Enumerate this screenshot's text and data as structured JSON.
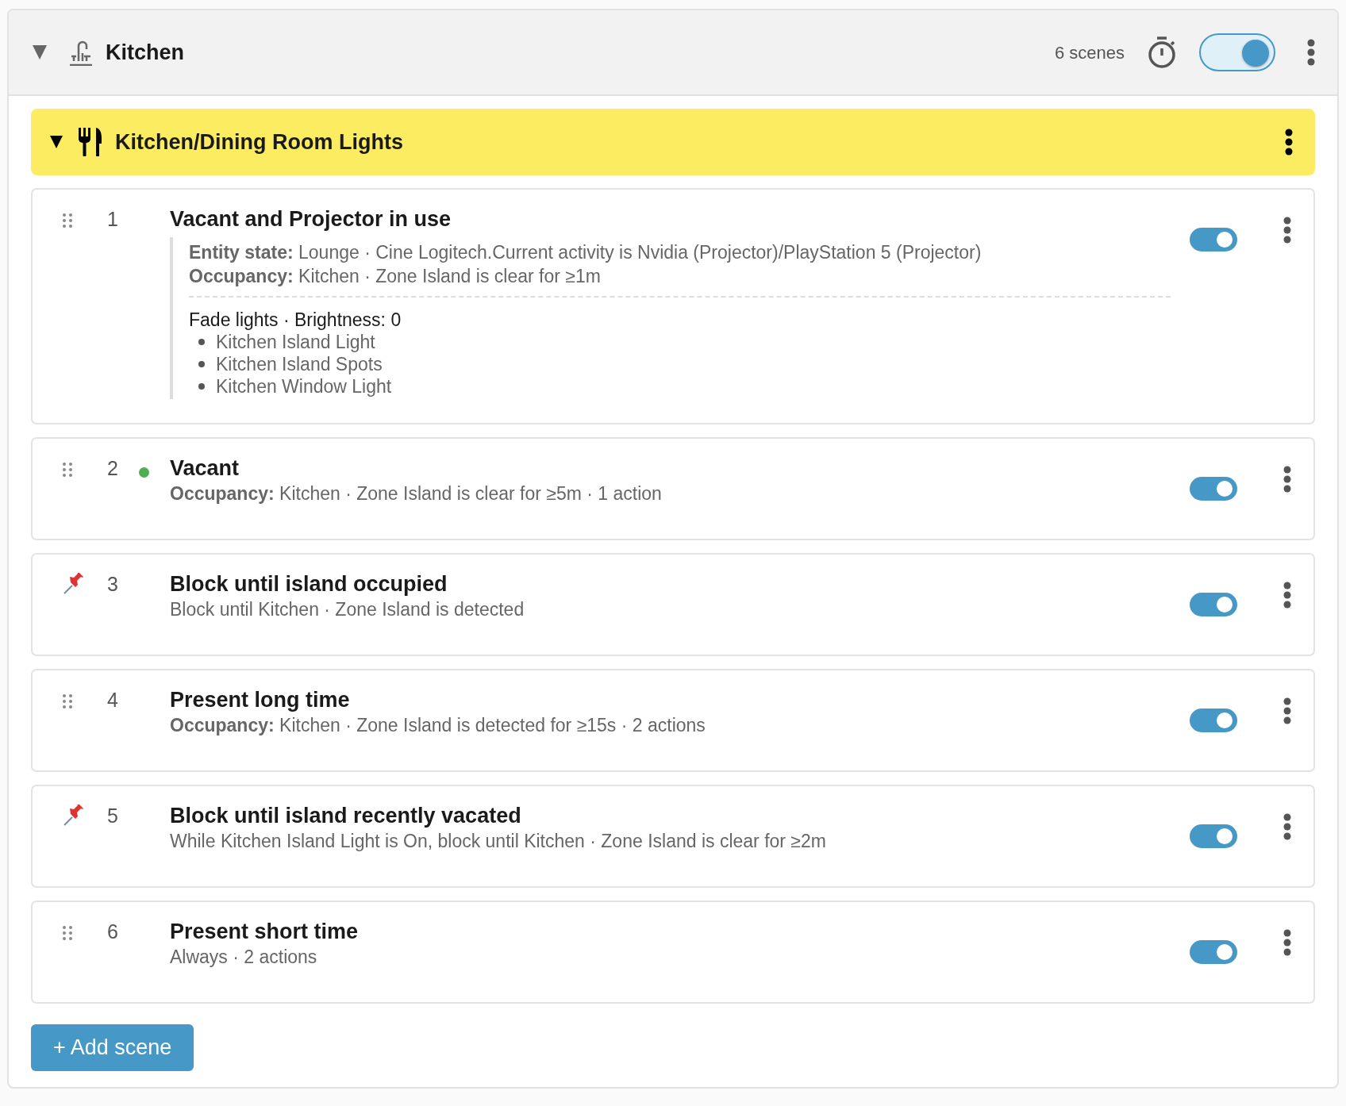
{
  "room": {
    "name": "Kitchen",
    "expanded": true,
    "scene_count": "6 scenes",
    "enabled": true
  },
  "group": {
    "name": "Kitchen/Dining Room Lights",
    "expanded": true
  },
  "scenes": [
    {
      "number": "1",
      "pinned": false,
      "active": false,
      "enabled": true,
      "kind": "detailed",
      "title": "Vacant and Projector in use",
      "conditions": [
        "**Entity state:** Lounge · Cine Logitech.Current activity is Nvidia (Projector)/PlayStation 5 (Projector)",
        "**Occupancy:** Kitchen · Zone Island is clear for ≥1m"
      ],
      "action": "Fade lights · Brightness: 0",
      "targets": [
        "Kitchen Island Light",
        "Kitchen Island Spots",
        "Kitchen Window Light"
      ]
    },
    {
      "number": "2",
      "pinned": false,
      "active": true,
      "enabled": true,
      "kind": "summary",
      "title": "Vacant",
      "summary": "**Occupancy:** Kitchen · Zone Island is clear for ≥5m · 1 action"
    },
    {
      "number": "3",
      "pinned": true,
      "active": false,
      "enabled": true,
      "kind": "summary",
      "title": "Block until island occupied",
      "summary": "Block until Kitchen · Zone Island is detected"
    },
    {
      "number": "4",
      "pinned": false,
      "active": false,
      "enabled": true,
      "kind": "summary",
      "title": "Present long time",
      "summary": "**Occupancy:** Kitchen · Zone Island is detected for ≥15s · 2 actions"
    },
    {
      "number": "5",
      "pinned": true,
      "active": false,
      "enabled": true,
      "kind": "summary",
      "title": "Block until island recently vacated",
      "summary": "While Kitchen Island Light is On, block until Kitchen · Zone Island is clear for ≥2m"
    },
    {
      "number": "6",
      "pinned": false,
      "active": false,
      "enabled": true,
      "kind": "summary",
      "title": "Present short time",
      "summary": "Always · 2 actions"
    }
  ],
  "add_button": "+ Add scene"
}
